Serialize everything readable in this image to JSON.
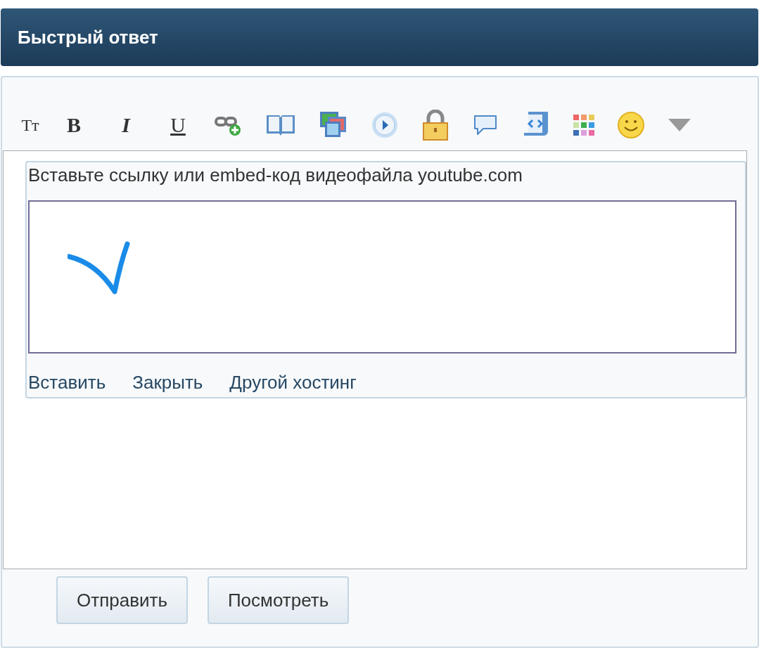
{
  "header": {
    "title": "Быстрый ответ"
  },
  "toolbar": {
    "text_buttons": [
      {
        "label": "Тт",
        "kind": "size"
      },
      {
        "label": "B",
        "kind": "bold"
      },
      {
        "label": "I",
        "kind": "italic"
      },
      {
        "label": "U",
        "kind": "underline"
      }
    ]
  },
  "embed_dialog": {
    "prompt": "Вставьте ссылку или embed-код видеофайла youtube.com",
    "links": [
      "Вставить",
      "Закрыть",
      "Другой хостинг"
    ]
  },
  "buttons": [
    "Отправить",
    "Посмотреть"
  ]
}
